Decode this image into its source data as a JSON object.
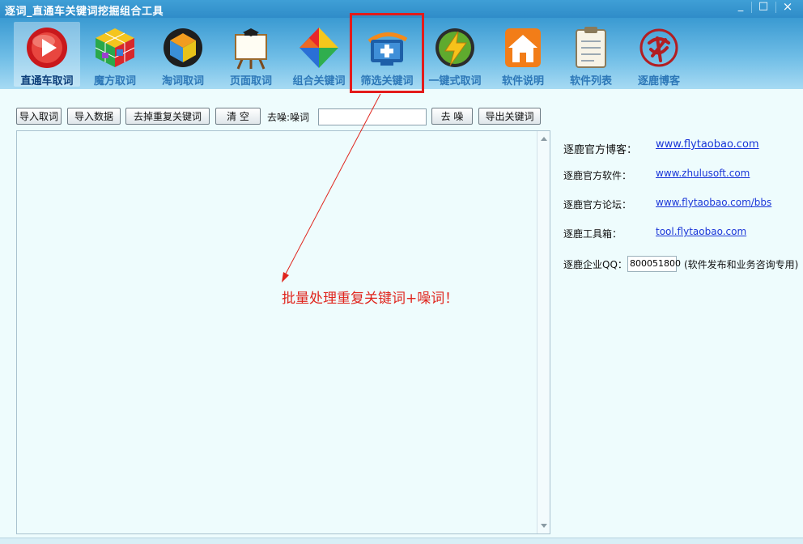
{
  "window": {
    "title": "逐词_直通车关键词挖掘组合工具",
    "min": "_",
    "max": "□",
    "close": "×"
  },
  "toolbar": {
    "items": [
      {
        "label": "直通车取词",
        "icon": "red-play-disc-icon"
      },
      {
        "label": "魔方取词",
        "icon": "rubik-cube-icon"
      },
      {
        "label": "淘词取词",
        "icon": "cube-3d-icon"
      },
      {
        "label": "页面取词",
        "icon": "easel-board-icon"
      },
      {
        "label": "组合关键词",
        "icon": "colorful-diamond-icon"
      },
      {
        "label": "筛选关键词",
        "icon": "monitor-plus-icon"
      },
      {
        "label": "一键式取词",
        "icon": "lightning-icon"
      },
      {
        "label": "软件说明",
        "icon": "home-icon"
      },
      {
        "label": "软件列表",
        "icon": "notepad-icon"
      },
      {
        "label": "逐鹿博客",
        "icon": "seal-logo-icon"
      }
    ],
    "active_index": 0,
    "highlighted_index": 5
  },
  "actions": {
    "import_words": "导入取词",
    "import_data": "导入数据",
    "dedupe": "去掉重复关键词",
    "clear": "清 空",
    "noise_label": "去噪:噪词",
    "noise_value": "",
    "denoise": "去 噪",
    "export": "导出关键词"
  },
  "annotation": "批量处理重复关键词+噪词！",
  "info": {
    "blog_label": "逐鹿官方博客：",
    "blog_link": "www.flytaobao.com",
    "software_label": "逐鹿官方软件：",
    "software_link": "www.zhulusoft.com",
    "forum_label": "逐鹿官方论坛：",
    "forum_link": "www.flytaobao.com/bbs",
    "toolbox_label": "逐鹿工具箱：",
    "toolbox_link": "tool.flytaobao.com",
    "qq_label": "逐鹿企业QQ：",
    "qq_value": "800051800",
    "qq_note": "(软件发布和业务咨询专用)"
  },
  "colors": {
    "highlight": "#e31b1b",
    "annotation": "#e0251d",
    "link": "#1a36d8"
  }
}
